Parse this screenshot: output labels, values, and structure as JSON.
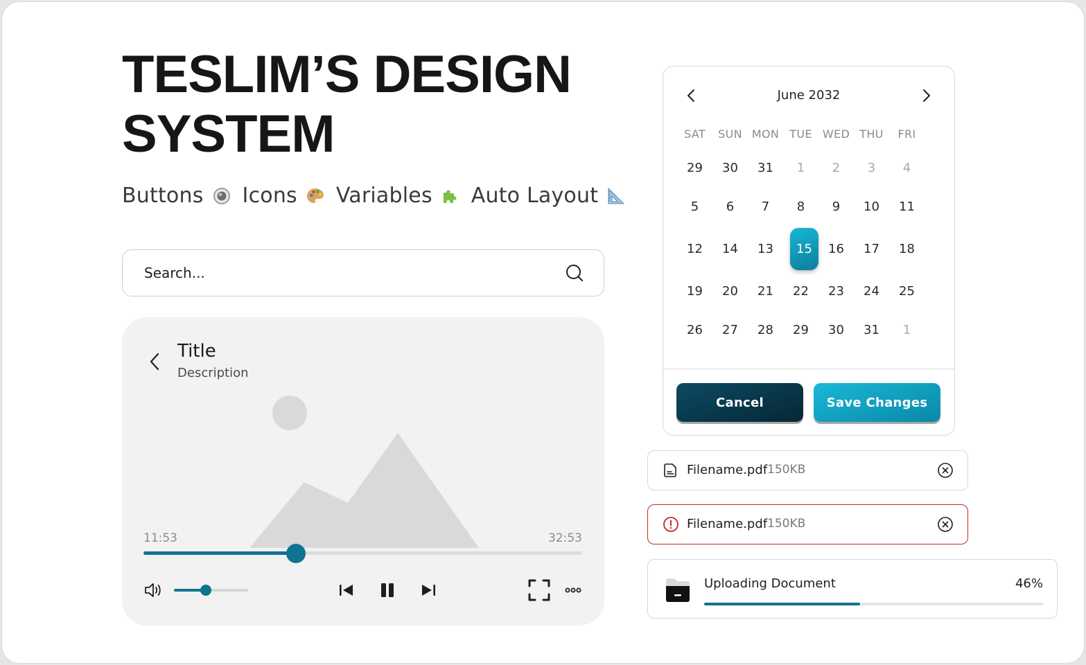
{
  "hero": {
    "title_line1": "TESLIM’S DESIGN",
    "title_line2": "SYSTEM"
  },
  "tags": [
    {
      "label": "Buttons",
      "icon": "radio-button-icon"
    },
    {
      "label": "Icons",
      "icon": "palette-icon"
    },
    {
      "label": "Variables",
      "icon": "puzzle-piece-icon"
    },
    {
      "label": "Auto Layout",
      "icon": "triangular-ruler-icon"
    }
  ],
  "search": {
    "placeholder": "Search..."
  },
  "player": {
    "title": "Title",
    "description": "Description",
    "elapsed": "11:53",
    "duration": "32:53",
    "progress": 0.348,
    "volume": 0.43,
    "accent": "#0e7490"
  },
  "calendar": {
    "month": "June 2032",
    "weekdays": [
      "SAT",
      "SUN",
      "MON",
      "TUE",
      "WED",
      "THU",
      "FRI"
    ],
    "weeks": [
      [
        {
          "d": "29",
          "m": false
        },
        {
          "d": "30",
          "m": false
        },
        {
          "d": "31",
          "m": false
        },
        {
          "d": "1",
          "m": true
        },
        {
          "d": "2",
          "m": true
        },
        {
          "d": "3",
          "m": true
        },
        {
          "d": "4",
          "m": true
        }
      ],
      [
        {
          "d": "5",
          "m": false
        },
        {
          "d": "6",
          "m": false
        },
        {
          "d": "7",
          "m": false
        },
        {
          "d": "8",
          "m": false
        },
        {
          "d": "9",
          "m": false
        },
        {
          "d": "10",
          "m": false
        },
        {
          "d": "11",
          "m": false
        }
      ],
      [
        {
          "d": "12",
          "m": false
        },
        {
          "d": "14",
          "m": false
        },
        {
          "d": "13",
          "m": false
        },
        {
          "d": "15",
          "m": false,
          "sel": true
        },
        {
          "d": "16",
          "m": false
        },
        {
          "d": "17",
          "m": false
        },
        {
          "d": "18",
          "m": false
        }
      ],
      [
        {
          "d": "19",
          "m": false
        },
        {
          "d": "20",
          "m": false
        },
        {
          "d": "21",
          "m": false
        },
        {
          "d": "22",
          "m": false
        },
        {
          "d": "23",
          "m": false
        },
        {
          "d": "24",
          "m": false
        },
        {
          "d": "25",
          "m": false
        }
      ],
      [
        {
          "d": "26",
          "m": false
        },
        {
          "d": "27",
          "m": false
        },
        {
          "d": "28",
          "m": false
        },
        {
          "d": "29",
          "m": false
        },
        {
          "d": "30",
          "m": false
        },
        {
          "d": "31",
          "m": false
        },
        {
          "d": "1",
          "m": true
        }
      ]
    ],
    "cancel_label": "Cancel",
    "save_label": "Save Changes"
  },
  "files": [
    {
      "name": "Filename.pdf",
      "size": "150KB",
      "state": "normal"
    },
    {
      "name": "Filename.pdf",
      "size": "150KB",
      "state": "error"
    }
  ],
  "upload": {
    "label": "Uploading Document",
    "percent_text": "46%",
    "progress": 0.46
  },
  "colors": {
    "accent": "#0e7490",
    "error": "#c62828",
    "primary_light": "#19b6d6",
    "primary_dark": "#062734"
  }
}
